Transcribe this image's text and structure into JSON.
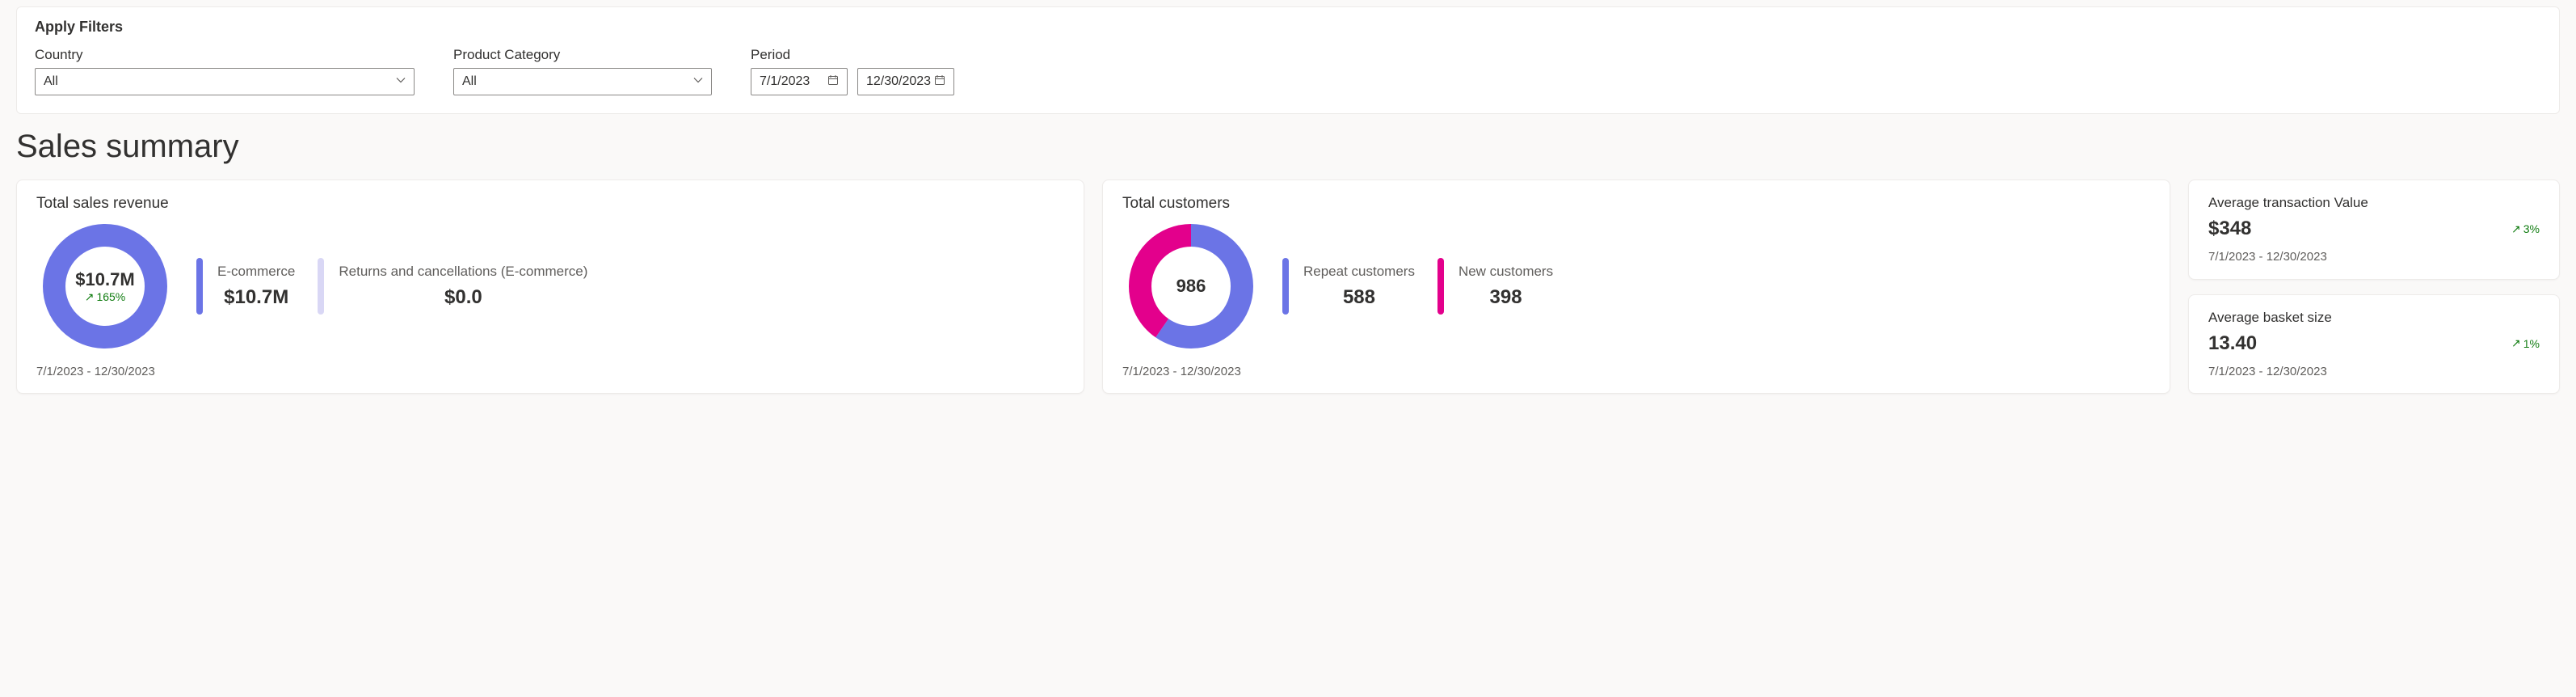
{
  "filters": {
    "title": "Apply Filters",
    "country": {
      "label": "Country",
      "value": "All"
    },
    "category": {
      "label": "Product Category",
      "value": "All"
    },
    "period": {
      "label": "Period",
      "from": "7/1/2023",
      "to": "12/30/2023"
    }
  },
  "section_title": "Sales summary",
  "revenue_card": {
    "title": "Total sales revenue",
    "total": "$10.7M",
    "trend": "165%",
    "ecommerce": {
      "label": "E-commerce",
      "value": "$10.7M",
      "color": "#6b74e6"
    },
    "returns": {
      "label": "Returns and cancellations (E-commerce)",
      "value": "$0.0",
      "color": "#d9d7f5"
    },
    "range": "7/1/2023 - 12/30/2023"
  },
  "customers_card": {
    "title": "Total customers",
    "total": "986",
    "repeat": {
      "label": "Repeat customers",
      "value": "588",
      "color": "#6b74e6"
    },
    "new": {
      "label": "New customers",
      "value": "398",
      "color": "#e3008c"
    },
    "range": "7/1/2023 - 12/30/2023"
  },
  "avg_txn": {
    "title": "Average transaction Value",
    "value": "$348",
    "trend": "3%",
    "range": "7/1/2023 - 12/30/2023"
  },
  "avg_basket": {
    "title": "Average basket size",
    "value": "13.40",
    "trend": "1%",
    "range": "7/1/2023 - 12/30/2023"
  },
  "chart_data": [
    {
      "type": "pie",
      "title": "Total sales revenue",
      "total_label": "$10.7M",
      "series": [
        {
          "name": "E-commerce",
          "value": 10.7,
          "unit": "$M",
          "color": "#6b74e6"
        },
        {
          "name": "Returns and cancellations (E-commerce)",
          "value": 0.0,
          "unit": "$M",
          "color": "#d9d7f5"
        }
      ]
    },
    {
      "type": "pie",
      "title": "Total customers",
      "total_label": "986",
      "series": [
        {
          "name": "Repeat customers",
          "value": 588,
          "color": "#6b74e6"
        },
        {
          "name": "New customers",
          "value": 398,
          "color": "#e3008c"
        }
      ]
    }
  ]
}
